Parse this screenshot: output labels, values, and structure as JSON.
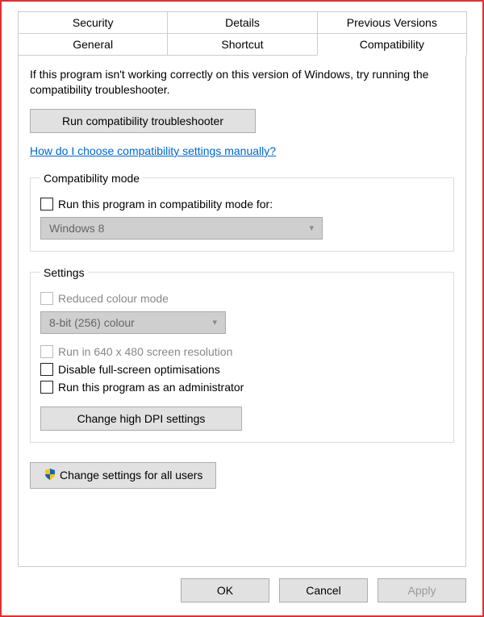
{
  "tabs": {
    "row1": [
      "Security",
      "Details",
      "Previous Versions"
    ],
    "row2": [
      "General",
      "Shortcut",
      "Compatibility"
    ],
    "active": "Compatibility"
  },
  "intro_text": "If this program isn't working correctly on this version of Windows, try running the compatibility troubleshooter.",
  "troubleshooter_btn": "Run compatibility troubleshooter",
  "help_link": "How do I choose compatibility settings manually?",
  "compat_mode": {
    "legend": "Compatibility mode",
    "checkbox_label": "Run this program in compatibility mode for:",
    "select_value": "Windows 8"
  },
  "settings": {
    "legend": "Settings",
    "reduced_colour": "Reduced colour mode",
    "colour_value": "8-bit (256) colour",
    "low_res": "Run in 640 x 480 screen resolution",
    "disable_fullscreen": "Disable full-screen optimisations",
    "run_admin": "Run this program as an administrator",
    "dpi_btn": "Change high DPI settings"
  },
  "all_users_btn": "Change settings for all users",
  "footer": {
    "ok": "OK",
    "cancel": "Cancel",
    "apply": "Apply"
  }
}
